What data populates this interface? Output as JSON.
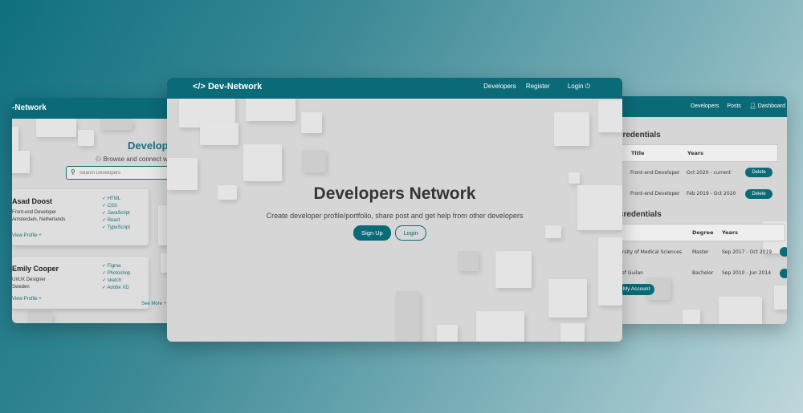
{
  "left_window": {
    "brand": "-Network",
    "page_title": "Develope",
    "subtitle": "Browse and connect w",
    "search_placeholder": "Search Developers",
    "profiles": [
      {
        "name": "Asad Doost",
        "role": "Front-end Developer",
        "location": "Amsterdam, Netherlands",
        "view_label": "View Profile +",
        "skills": [
          "HTML",
          "CSS",
          "JavaScript",
          "React",
          "TypeScript"
        ]
      },
      {
        "name": "Emily Cooper",
        "role": "UI/UX Designer",
        "location": "Sweden",
        "view_label": "View Profile +",
        "skills": [
          "Figma",
          "Photoshop",
          "sketch",
          "Adobe XD"
        ]
      }
    ],
    "see_more": "See More +"
  },
  "main_window": {
    "brand": "Dev-Network",
    "nav": {
      "developers": "Developers",
      "register": "Register",
      "login": "Login"
    },
    "hero_title": "Developers Network",
    "hero_subtitle": "Create developer profile/portfolio, share post and get help from other developers",
    "signup_label": "Sign Up",
    "login_label": "Login"
  },
  "right_window": {
    "nav": {
      "developers": "Developers",
      "posts": "Posts",
      "dashboard": "Dashboard"
    },
    "experience_heading": "ce credentials",
    "experience_headers": [
      "Title",
      "Years"
    ],
    "experience_rows": [
      {
        "title": "Front-end Developer",
        "years": "Oct 2020 - current",
        "action": "Delete"
      },
      {
        "title": "Front-end Developer",
        "years": "Feb 2019 - Oct 2020",
        "action": "Delete"
      }
    ],
    "education_heading": "n credentials",
    "education_headers": [
      "Degree",
      "Years"
    ],
    "education_rows": [
      {
        "school": "iversity of Medical Sciences",
        "degree": "Master",
        "years": "Sep 2017 - Oct 2019"
      },
      {
        "school": "of Guilan",
        "degree": "Bachelor",
        "years": "Sep 2010 - Jun 2014"
      }
    ],
    "account_button": "My Account"
  }
}
